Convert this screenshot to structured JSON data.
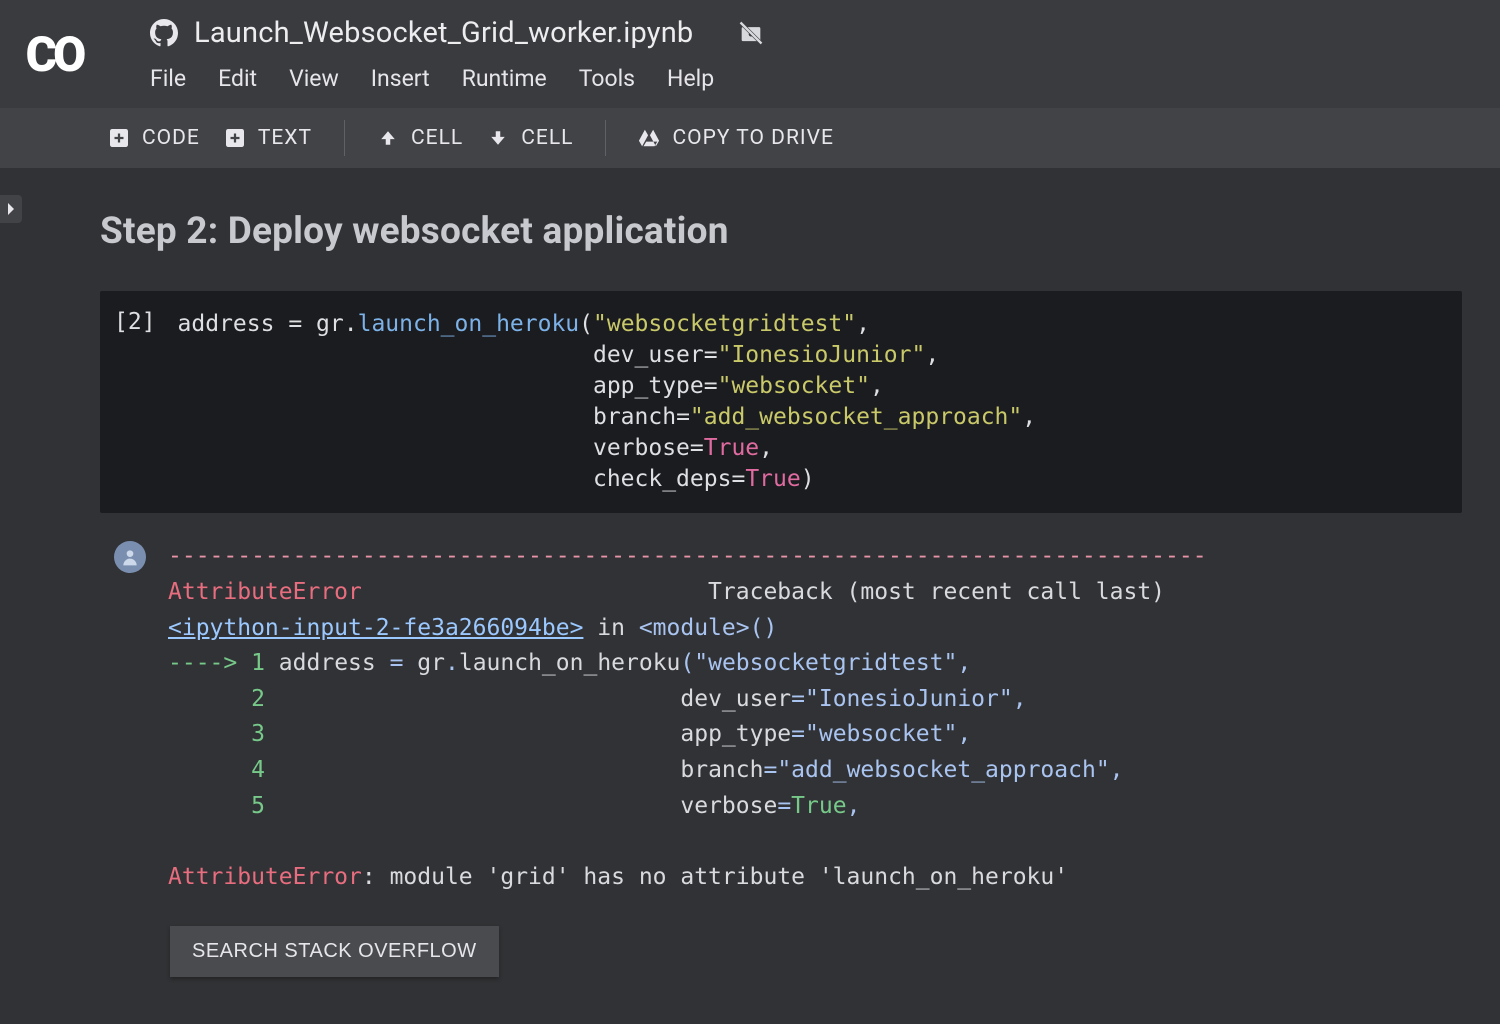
{
  "header": {
    "notebook_title": "Launch_Websocket_Grid_worker.ipynb",
    "menus": {
      "file": "File",
      "edit": "Edit",
      "view": "View",
      "insert": "Insert",
      "runtime": "Runtime",
      "tools": "Tools",
      "help": "Help"
    }
  },
  "toolbar": {
    "code": "CODE",
    "text": "TEXT",
    "cell_up": "CELL",
    "cell_down": "CELL",
    "copy": "COPY TO DRIVE"
  },
  "section": {
    "title": "Step 2: Deploy websocket application"
  },
  "cell": {
    "exec_label": "[2]",
    "code": {
      "l1a": "address ",
      "l1b": "=",
      "l1c": " gr",
      "l1d": ".",
      "l1e": "launch_on_heroku",
      "l1f": "(",
      "l1g": "\"websocketgridtest\"",
      "l1h": ",",
      "pad": "                              ",
      "l2a": "dev_user",
      "l2b": "=",
      "l2c": "\"IonesioJunior\"",
      "l2d": ",",
      "l3a": "app_type",
      "l3b": "=",
      "l3c": "\"websocket\"",
      "l3d": ",",
      "l4a": "branch",
      "l4b": "=",
      "l4c": "\"add_websocket_approach\"",
      "l4d": ",",
      "l5a": "verbose",
      "l5b": "=",
      "l5c": "True",
      "l5d": ",",
      "l6a": "check_deps",
      "l6b": "=",
      "l6c": "True",
      "l6d": ")"
    }
  },
  "output": {
    "dash": "---------------------------------------------------------------------------",
    "err_name": "AttributeError",
    "tb_label": "                         Traceback (most recent call last)",
    "link": "<ipython-input-2-fe3a266094be>",
    "in": " in ",
    "module": "<module>",
    "parens": "()",
    "arrow": "----> ",
    "n1": "1",
    "n2": "2",
    "n3": "3",
    "n4": "4",
    "n5": "5",
    "pad6": "      ",
    "r1a": " address ",
    "r1b": "=",
    "r1c": " gr",
    "r1d": ".",
    "r1e": "launch_on_heroku",
    "r1f": "(",
    "r1g": "\"websocketgridtest\"",
    "r1h": ",",
    "rpad": "                              ",
    "r2a": "dev_user",
    "r2b": "=",
    "r2c": "\"IonesioJunior\"",
    "r2d": ",",
    "r3a": "app_type",
    "r3b": "=",
    "r3c": "\"websocket\"",
    "r3d": ",",
    "r4a": "branch",
    "r4b": "=",
    "r4c": "\"add_websocket_approach\"",
    "r4d": ",",
    "r5a": "verbose",
    "r5b": "=",
    "r5c": "True",
    "r5d": ",",
    "final_err": "AttributeError",
    "final_msg": ": module 'grid' has no attribute 'launch_on_heroku'",
    "so_button": "SEARCH STACK OVERFLOW"
  }
}
